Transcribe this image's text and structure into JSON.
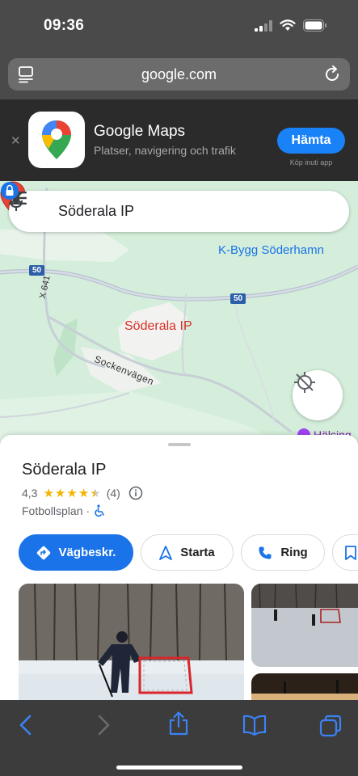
{
  "status_bar": {
    "time": "09:36"
  },
  "browser": {
    "url": "google.com"
  },
  "banner": {
    "app_name": "Google Maps",
    "app_subtitle": "Platser, navigering och trafik",
    "get_label": "Hämta",
    "get_note": "Köp inuti app"
  },
  "map": {
    "search_text": "Söderala IP",
    "poi_label": "K-Bygg Söderhamn",
    "place_label": "Söderala IP",
    "road_50_a": "50",
    "road_50_b": "50",
    "road_x641": "X 641",
    "street": "Sockenvägen",
    "cut_label": "Hälsing"
  },
  "place": {
    "title": "Söderala IP",
    "rating": "4,3",
    "stars": 4.3,
    "review_count": "(4)",
    "category": "Fotbollsplan",
    "separator": "·"
  },
  "actions": {
    "directions": "Vägbeskr.",
    "start": "Starta",
    "call": "Ring"
  },
  "colors": {
    "accent": "#1a73e8",
    "pin": "#d93025",
    "star": "#f4b400",
    "app_store_blue": "#1a82f7"
  }
}
